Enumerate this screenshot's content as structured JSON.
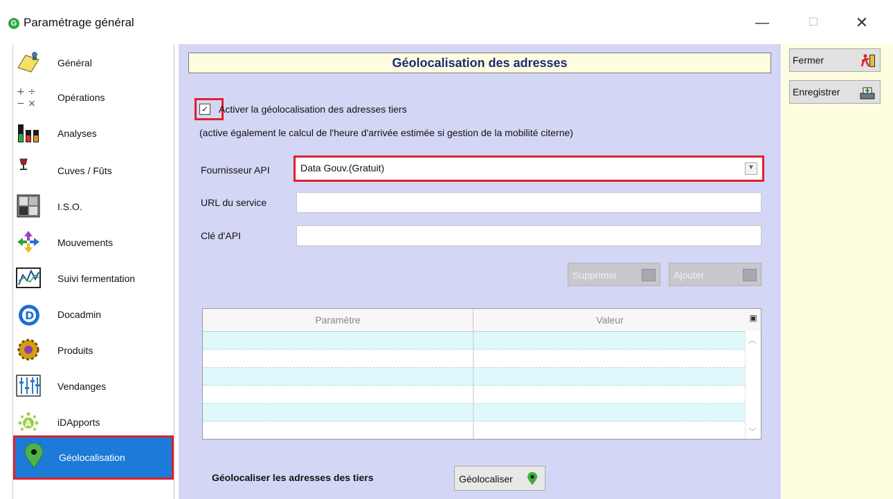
{
  "window": {
    "title": "Paramétrage général",
    "minimize": "—",
    "maximize": "☐",
    "close": "✕",
    "app_icon": "G"
  },
  "sidebar": {
    "items": [
      {
        "label": "Général",
        "icon": "general-icon"
      },
      {
        "label": "Opérations",
        "icon": "operations-icon"
      },
      {
        "label": "Analyses",
        "icon": "analyses-icon"
      },
      {
        "label": "Cuves / Fûts",
        "icon": "cuves-icon"
      },
      {
        "label": "I.S.O.",
        "icon": "iso-icon"
      },
      {
        "label": "Mouvements",
        "icon": "mouvements-icon"
      },
      {
        "label": "Suivi fermentation",
        "icon": "fermentation-icon"
      },
      {
        "label": "Docadmin",
        "icon": "docadmin-icon"
      },
      {
        "label": "Produits",
        "icon": "produits-icon"
      },
      {
        "label": "Vendanges",
        "icon": "vendanges-icon"
      },
      {
        "label": "iDApports",
        "icon": "idapports-icon"
      },
      {
        "label": "Géolocalisation",
        "icon": "map-pin-icon",
        "active": true
      }
    ]
  },
  "main": {
    "header": "Géolocalisation des adresses",
    "checkbox": {
      "checked": true,
      "mark": "✓",
      "label": "Activer la géolocalisation des adresses tiers",
      "note": "(active également le calcul de l'heure d'arrivée estimée si gestion de la mobilité citerne)"
    },
    "provider": {
      "label": "Fournisseur API",
      "value": "Data Gouv.(Gratuit)"
    },
    "url": {
      "label": "URL du service",
      "value": ""
    },
    "apikey": {
      "label": "Clé d'API",
      "value": ""
    },
    "buttons": {
      "delete": "Supprimer",
      "add": "Ajouter"
    },
    "table": {
      "columns": [
        "Paramètre",
        "Valeur"
      ],
      "rows": [
        [
          "",
          ""
        ],
        [
          "",
          ""
        ],
        [
          "",
          ""
        ],
        [
          "",
          ""
        ],
        [
          "",
          ""
        ],
        [
          "",
          ""
        ]
      ]
    },
    "geolocate": {
      "label": "Géolocaliser les adresses des tiers",
      "button": "Géolocaliser"
    }
  },
  "actions": {
    "close": "Fermer",
    "save": "Enregistrer"
  },
  "colors": {
    "active_item": "#1c7ad8",
    "highlight": "#e0202a",
    "panel_bg": "#d4d6f5",
    "header_bg": "#fffde0",
    "header_text": "#1c2a78",
    "pin_green": "#3cae3c"
  }
}
